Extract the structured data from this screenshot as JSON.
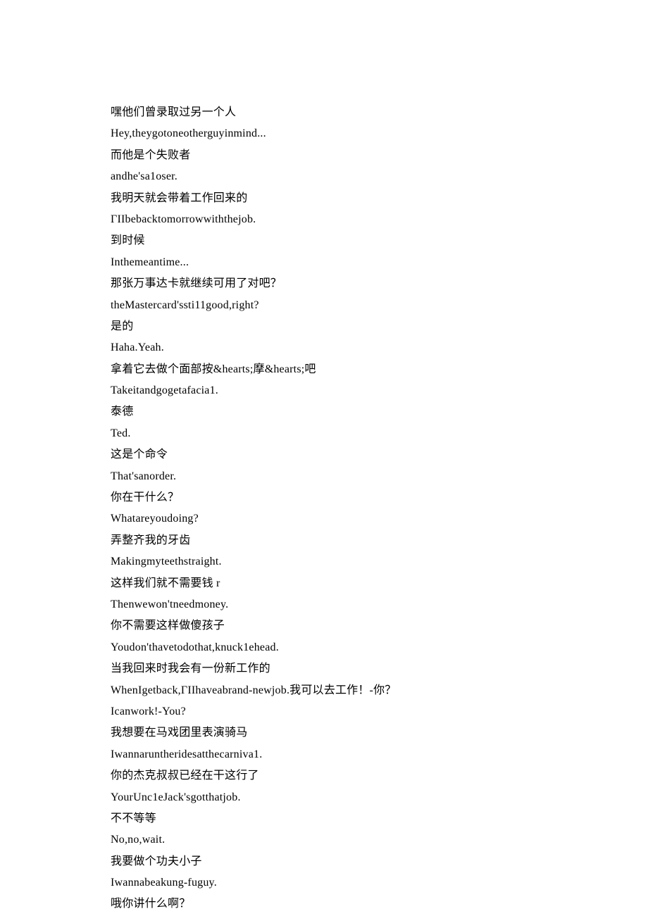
{
  "lines": [
    "嘿他们曾录取过另一个人",
    "Hey,theygotoneotherguyinmind...",
    "而他是个失败者",
    "andhe'sa1oser.",
    "我明天就会带着工作回来的",
    "ΓIIbebacktomorrowwiththejob.",
    "到时候",
    "Inthemeantime...",
    "那张万事达卡就继续可用了对吧？",
    "theMastercard'ssti11good,right?",
    "是的",
    "Haha.Yeah.",
    "拿着它去做个面部按&hearts;摩&hearts;吧",
    "Takeitandgogetafacia1.",
    "泰德",
    "Ted.",
    "这是个命令",
    "That'sanorder.",
    "你在干什么？",
    "Whatareyoudoing?",
    "弄整齐我的牙齿",
    "Makingmyteethstraight.",
    "这样我们就不需要钱 r",
    "Thenwewon'tneedmoney.",
    "你不需要这样做傻孩子",
    "Youdon'thavetodothat,knuck1ehead.",
    "当我回来时我会有一份新工作的",
    "WhenIgetback,ΓIIhaveabrand-newjob.我可以去工作！-你？",
    "Icanwork!-You?",
    "我想要在马戏团里表演骑马",
    "Iwannaruntheridesatthecarniva1.",
    "你的杰克叔叔已经在干这行了",
    "YourUnc1eJack'sgotthatjob.",
    "不不等等",
    "No,no,wait.",
    "我要做个功夫小子",
    "Iwannabeakung-fuguy.",
    "哦你讲什么啊？"
  ]
}
